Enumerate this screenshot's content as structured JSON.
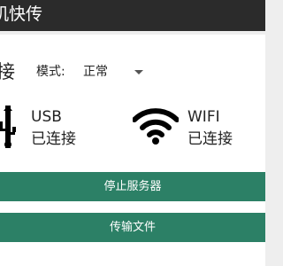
{
  "app": {
    "title": "机快传"
  },
  "connection": {
    "title": "接",
    "mode_label": "模式:",
    "mode_value": "正常"
  },
  "usb": {
    "name": "USB",
    "status": "已连接",
    "icon": "usb-icon"
  },
  "wifi": {
    "name": "WIFI",
    "status": "已连接",
    "icon": "wifi-icon"
  },
  "buttons": {
    "stop_server": "停止服务器",
    "transfer_files": "传输文件"
  },
  "colors": {
    "appbar": "#2b2b2b",
    "accent_button": "#2c8066",
    "card": "#ffffff",
    "background": "#eeeeee"
  }
}
